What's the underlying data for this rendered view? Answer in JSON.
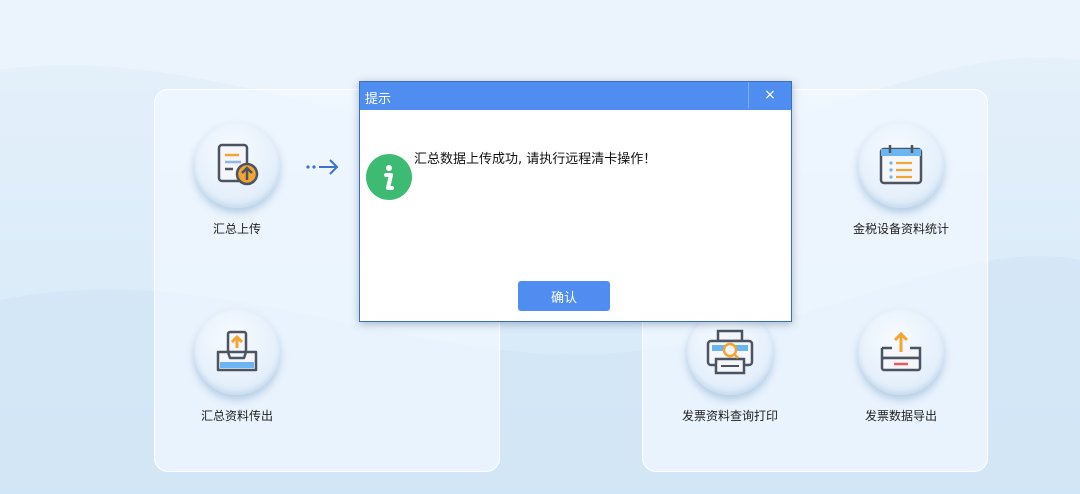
{
  "tiles": {
    "upload": {
      "label": "汇总上传",
      "icon": "document-upload-icon"
    },
    "export": {
      "label": "汇总资料传出",
      "icon": "inbox-upload-icon"
    },
    "device_stats": {
      "label": "金税设备资料统计",
      "icon": "calendar-list-icon"
    },
    "invoice_print": {
      "label": "发票资料查询打印",
      "icon": "printer-search-icon"
    },
    "invoice_export": {
      "label": "发票数据导出",
      "icon": "tray-export-icon"
    }
  },
  "flow_arrow_icon": "dotted-arrow-right-icon",
  "dialog": {
    "title": "提示",
    "close_label": "×",
    "message": "汇总数据上传成功, 请执行远程清卡操作！",
    "icon": "info-icon",
    "ok_label": "确认"
  },
  "colors": {
    "accent": "#4f8ef0",
    "info_green": "#3dbb72",
    "icon_orange": "#f3a52f",
    "icon_stroke": "#4a5462"
  }
}
